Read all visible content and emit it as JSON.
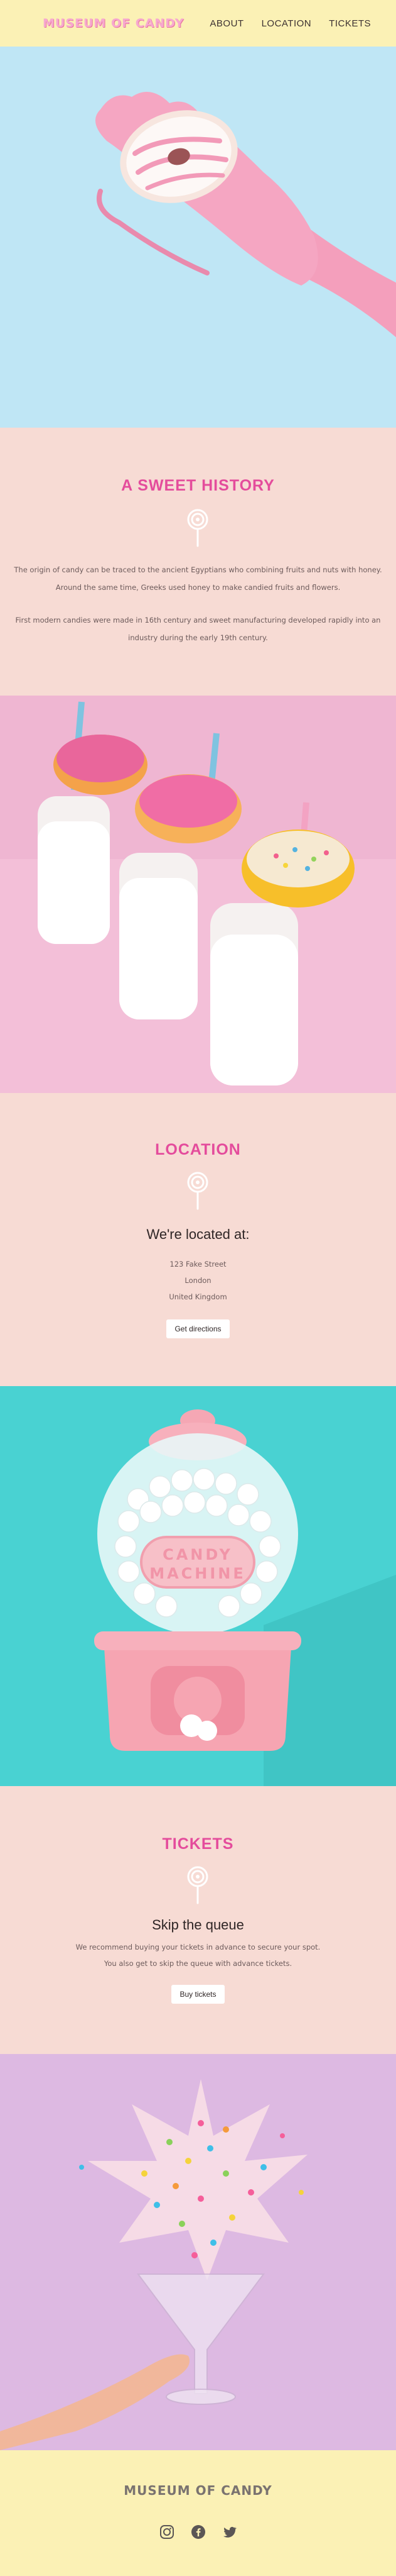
{
  "header": {
    "logo": "MUSEUM OF CANDY",
    "nav": [
      "ABOUT",
      "LOCATION",
      "TICKETS"
    ]
  },
  "history": {
    "title": "A SWEET HISTORY",
    "paragraph1": "The origin of candy can be traced to the ancient Egyptians who combining fruits and nuts with honey. Around the same time, Greeks used honey to make candied fruits and flowers.",
    "paragraph2": "First modern candies were made in 16th century and sweet manufacturing developed rapidly into an industry during the early 19th century."
  },
  "location": {
    "title": "LOCATION",
    "subtitle": "We're located at:",
    "address": [
      "123 Fake Street",
      "London",
      "United Kingdom"
    ],
    "button": "Get directions"
  },
  "gumball": {
    "sign": [
      "CANDY",
      "MACHINE"
    ]
  },
  "tickets": {
    "title": "TICKETS",
    "subtitle": "Skip the queue",
    "line1": "We recommend buying your tickets in advance to secure your spot.",
    "line2": "You also get to skip the queue with advance tickets.",
    "button": "Buy tickets"
  },
  "footer": {
    "logo": "MUSEUM OF CANDY",
    "socials": [
      "instagram-icon",
      "facebook-icon",
      "twitter-icon"
    ]
  },
  "colors": {
    "header_bg": "#fbf1b5",
    "section_bg": "#f7dbd4",
    "accent": "#e44c9c",
    "hero_bg": "#bfe6f5",
    "gumball_bg": "#49d2d2",
    "cocktail_bg": "#ddb9e2"
  }
}
